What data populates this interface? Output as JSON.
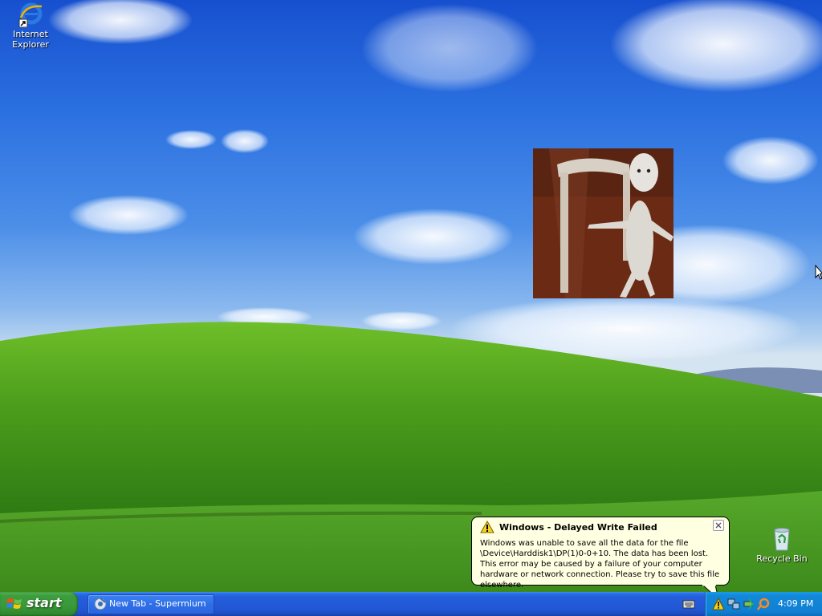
{
  "desktop": {
    "icons": [
      {
        "label": "Internet Explorer",
        "icon": "internet-explorer-icon"
      },
      {
        "label": "Recycle Bin",
        "icon": "recycle-bin-icon"
      }
    ],
    "photo": {
      "subject": "white-rat-photo"
    }
  },
  "taskbar": {
    "start_label": "start",
    "task_button": {
      "label": "New Tab - Supermium",
      "icon": "supermium-browser-icon"
    },
    "tray": {
      "icons": [
        "warning-icon",
        "network-icon",
        "safely-remove-hardware-icon",
        "search-icon"
      ],
      "clock": "4:09 PM"
    }
  },
  "balloon": {
    "title": "Windows - Delayed Write Failed",
    "body": "Windows was unable to save all the data for the file \\Device\\Harddisk1\\DP(1)0-0+10. The data has been lost. This error may be caused by a failure of your computer hardware or network connection. Please try to save this file elsewhere."
  },
  "colors": {
    "taskbar": "#245edb",
    "start_button": "#3a983a",
    "tray": "#0f80d3",
    "balloon_bg": "#ffffe1"
  }
}
